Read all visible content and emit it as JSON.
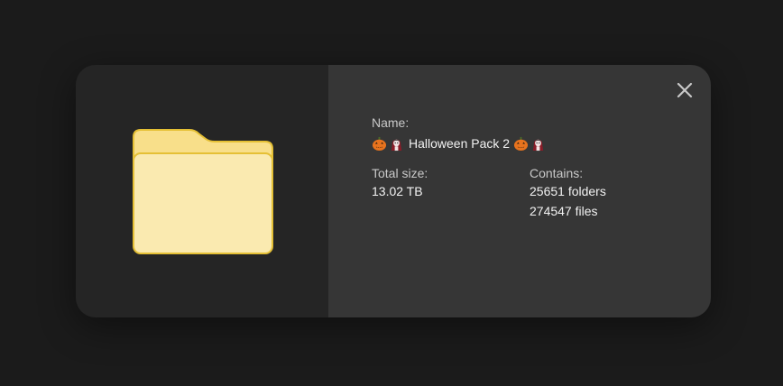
{
  "dialog": {
    "name_label": "Name:",
    "name_prefix_icons": [
      "pumpkin-icon",
      "vampire-icon"
    ],
    "name_value": "Halloween Pack 2",
    "name_suffix_icons": [
      "pumpkin-icon",
      "vampire-icon"
    ],
    "total_size_label": "Total size:",
    "total_size_value": "13.02 TB",
    "contains_label": "Contains:",
    "folders_value": "25651 folders",
    "files_value": "274547 files",
    "close_icon": "close-icon",
    "folder_icon": "folder-icon"
  },
  "colors": {
    "background": "#1b1b1b",
    "left_pane": "#252525",
    "right_pane": "#363636",
    "folder_fill": "#faeab0",
    "folder_stroke": "#e8c43a"
  }
}
